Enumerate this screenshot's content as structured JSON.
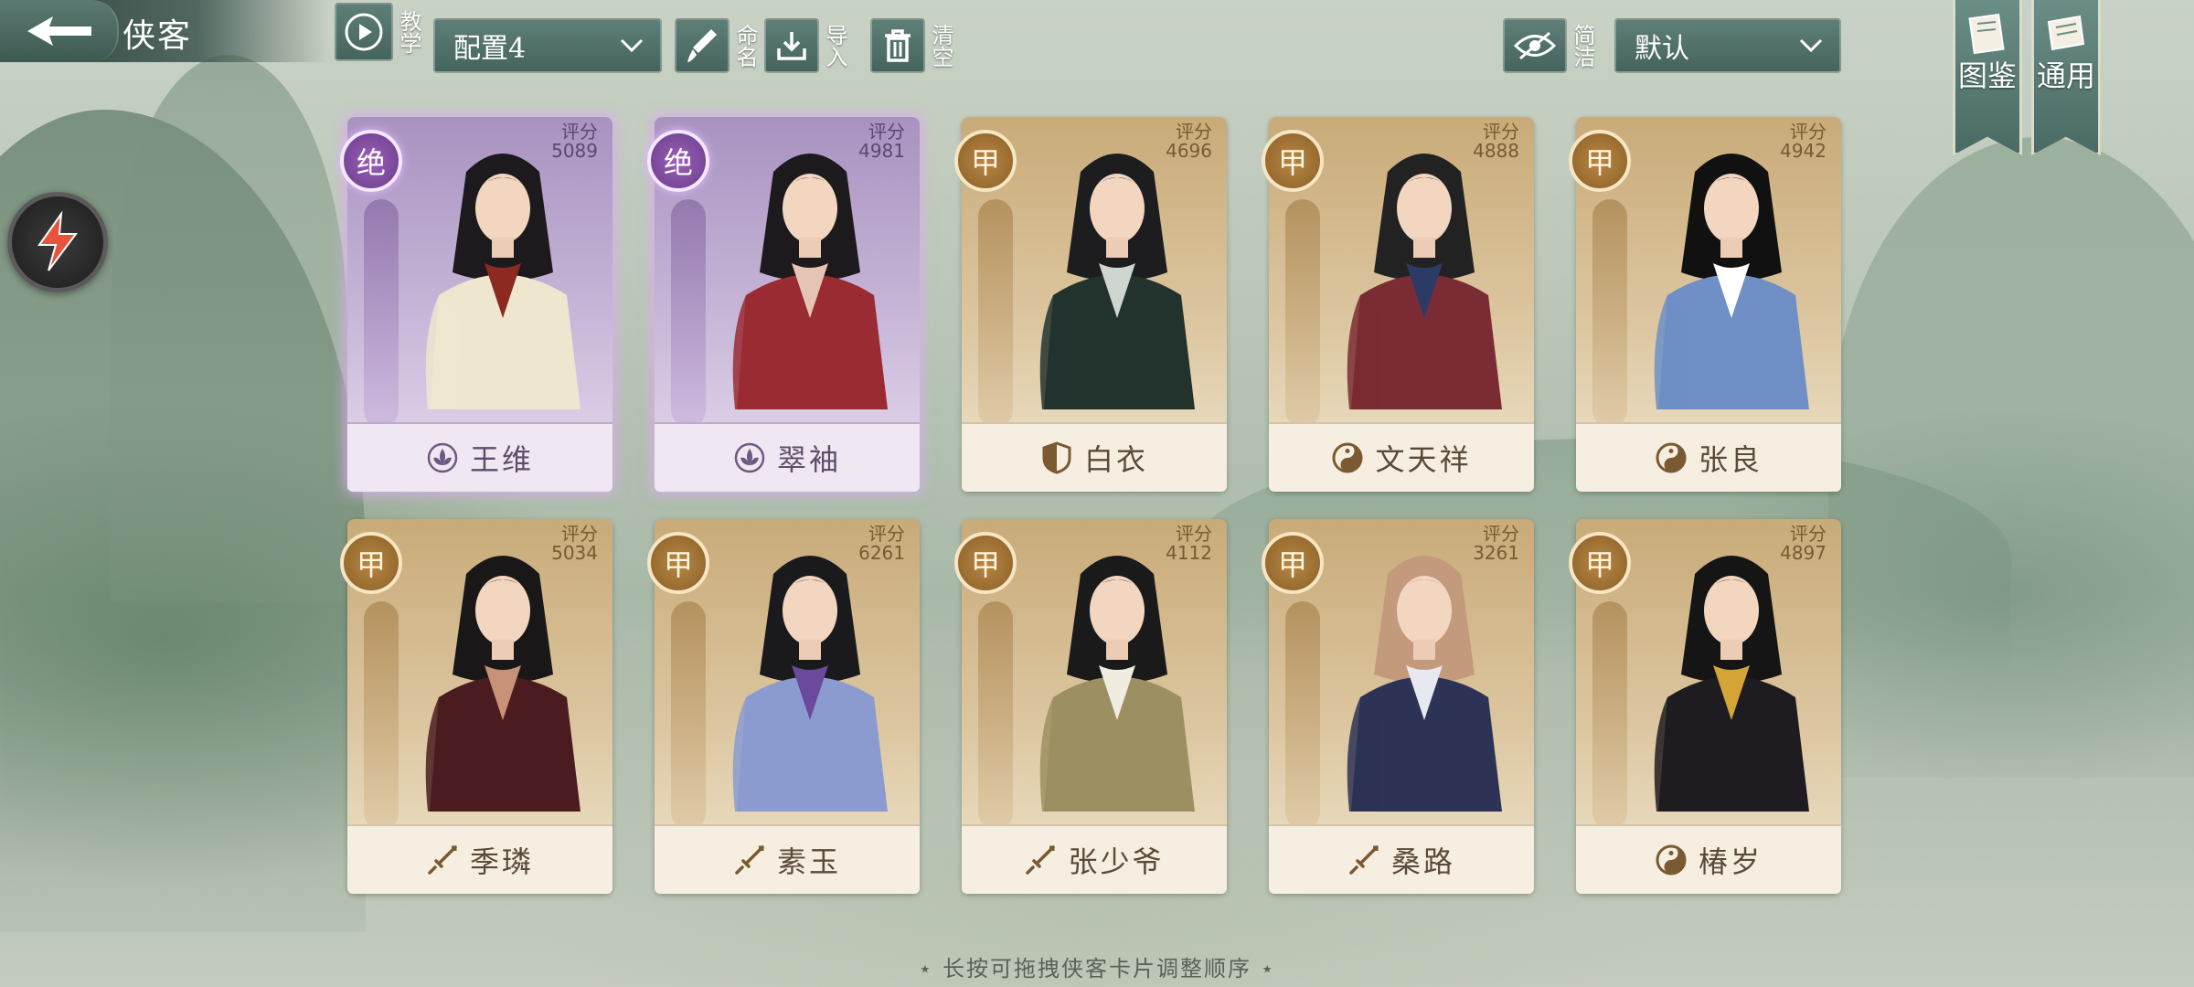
{
  "header": {
    "title": "侠客",
    "tutorial_label": "教学",
    "config_select": "配置4",
    "rename_label": "命名",
    "import_label": "导入",
    "clear_label": "清空",
    "simple_label": "简洁",
    "sort_select": "默认",
    "atlas_label": "图鉴",
    "general_label": "通用"
  },
  "cards": [
    {
      "rank": "绝",
      "score_label": "评分",
      "score": "5089",
      "name": "王维",
      "tier": "purple",
      "type_icon": "lotus-icon",
      "hair": "#1c1a1d",
      "robe": "#efe6d0",
      "accent": "#8c2a22"
    },
    {
      "rank": "绝",
      "score_label": "评分",
      "score": "4981",
      "name": "翠袖",
      "tier": "purple",
      "type_icon": "lotus-icon",
      "hair": "#1c1a1d",
      "robe": "#9a2b33",
      "accent": "#e6c4b4"
    },
    {
      "rank": "甲",
      "score_label": "评分",
      "score": "4696",
      "name": "白衣",
      "tier": "gold",
      "type_icon": "shield-icon",
      "hair": "#1d1d1f",
      "robe": "#22332e",
      "accent": "#cfd6d0"
    },
    {
      "rank": "甲",
      "score_label": "评分",
      "score": "4888",
      "name": "文天祥",
      "tier": "gold",
      "type_icon": "taiji-icon",
      "hair": "#222",
      "robe": "#7a2b33",
      "accent": "#2b3b65"
    },
    {
      "rank": "甲",
      "score_label": "评分",
      "score": "4942",
      "name": "张良",
      "tier": "gold",
      "type_icon": "taiji-icon",
      "hair": "#111",
      "robe": "#6f8fc6",
      "accent": "#ffffff"
    },
    {
      "rank": "甲",
      "score_label": "评分",
      "score": "5034",
      "name": "季璘",
      "tier": "gold",
      "type_icon": "sword-icon",
      "hair": "#1a1718",
      "robe": "#4a1c20",
      "accent": "#c79278"
    },
    {
      "rank": "甲",
      "score_label": "评分",
      "score": "6261",
      "name": "素玉",
      "tier": "gold",
      "type_icon": "sword-icon",
      "hair": "#1a1a1d",
      "robe": "#8b9bd0",
      "accent": "#6b4a9e"
    },
    {
      "rank": "甲",
      "score_label": "评分",
      "score": "4112",
      "name": "张少爷",
      "tier": "gold",
      "type_icon": "sword-icon",
      "hair": "#1a1a1a",
      "robe": "#9c8f62",
      "accent": "#f0ece0"
    },
    {
      "rank": "甲",
      "score_label": "评分",
      "score": "3261",
      "name": "桑路",
      "tier": "gold",
      "type_icon": "sword-icon",
      "hair": "#c49a7c",
      "robe": "#2c3354",
      "accent": "#e8e8f0"
    },
    {
      "rank": "甲",
      "score_label": "评分",
      "score": "4897",
      "name": "椿岁",
      "tier": "gold",
      "type_icon": "taiji-icon",
      "hair": "#151515",
      "robe": "#1e1c20",
      "accent": "#d4a436"
    }
  ],
  "hint": "⋆ 长按可拖拽侠客卡片调整顺序 ⋆",
  "colors": {
    "accent_teal": "#4f6f69",
    "purple_glow": "#e2b8ff",
    "gold_frame": "#c9ab79"
  }
}
